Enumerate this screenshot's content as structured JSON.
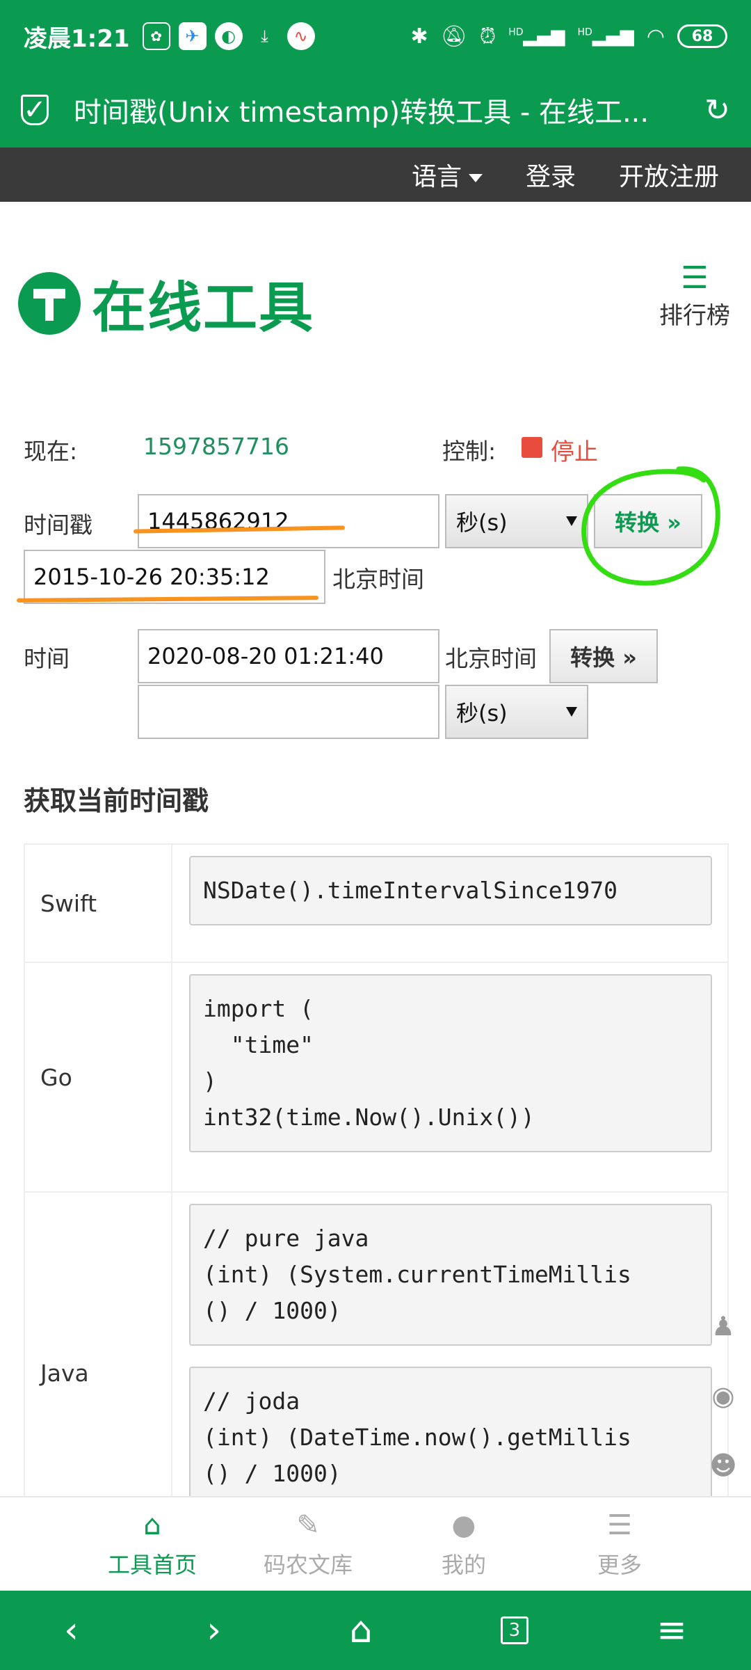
{
  "status_bar": {
    "time": "凌晨1:21",
    "battery": "68",
    "hd1": "HD",
    "hd2": "HD"
  },
  "browser": {
    "title": "时间戳(Unix timestamp)转换工具 - 在线工..."
  },
  "topnav": {
    "language": "语言",
    "login": "登录",
    "register": "开放注册"
  },
  "logo": {
    "text": "在线工具",
    "rank_label": "排行榜"
  },
  "now_row": {
    "label": "现在:",
    "value": "1597857716",
    "control_label": "控制:",
    "stop_label": "停止"
  },
  "timestamp_row": {
    "label": "时间戳",
    "input_value": "1445862912",
    "unit": "秒(s)",
    "convert_label": "转换 »",
    "result_value": "2015-10-26 20:35:12",
    "result_tz": "北京时间"
  },
  "time_row": {
    "label": "时间",
    "input_value": "2020-08-20 01:21:40",
    "tz": "北京时间",
    "convert_label": "转换 »",
    "result_value": "",
    "unit": "秒(s)"
  },
  "section": {
    "title": "获取当前时间戳"
  },
  "code_table": [
    {
      "lang": "Swift",
      "codes": [
        "NSDate().timeIntervalSince1970"
      ]
    },
    {
      "lang": "Go",
      "codes": [
        "import (\n  \"time\"\n)\nint32(time.Now().Unix())"
      ]
    },
    {
      "lang": "Java",
      "codes": [
        "// pure java\n(int) (System.currentTimeMillis\n() / 1000)",
        "// joda\n(int) (DateTime.now().getMillis\n() / 1000)"
      ]
    }
  ],
  "bottom_tabs": [
    {
      "label": "工具首页",
      "icon": "home-icon"
    },
    {
      "label": "码农文库",
      "icon": "pencil-icon"
    },
    {
      "label": "我的",
      "icon": "user-icon"
    },
    {
      "label": "更多",
      "icon": "menu-icon"
    }
  ],
  "sysnav": {
    "tab_count": "3"
  },
  "colors": {
    "brand_green": "#0a9b50",
    "stop_red": "#e74c3c",
    "annotation_orange": "#f7931e",
    "annotation_green": "#33dd11"
  }
}
